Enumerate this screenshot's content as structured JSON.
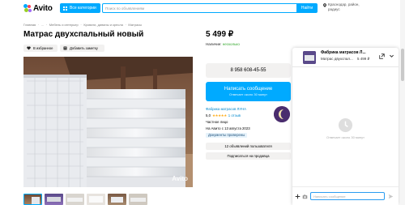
{
  "header": {
    "logo_text": "Avito",
    "categories_label": "Все категории",
    "search_placeholder": "Поиск по объявлениям",
    "find_label": "Найти",
    "location_line1": "Краснодар, район,",
    "location_line2": "радиус"
  },
  "breadcrumbs": [
    "Главная",
    "·",
    "...",
    "·",
    "Мебель и интерьер",
    "·",
    "Кровати, диваны и кресла",
    "·",
    "Матрасы"
  ],
  "listing": {
    "title": "Матрас двухспальный новый",
    "price": "5 499 ₽",
    "availability_label": "Наличие:",
    "availability_value": "несколько",
    "favorite_label": "В избранное",
    "note_label": "Добавить заметку",
    "photo_watermark": "Avito"
  },
  "contact": {
    "phone": "8 958 608-45-55",
    "message_label": "Написать сообщение",
    "message_sub": "Отвечает около 30 минут"
  },
  "seller": {
    "name": "Фабрика матрасов ЛУНА",
    "rating": "5,0",
    "stars": "★★★★★",
    "reviews": "1 отзыв",
    "type": "Частное лицо",
    "since": "На Авито с 13 августа 2023",
    "docs_badge": "Документы проверены",
    "ads_count": "12 объявлений пользователя",
    "subscribe_label": "Подписаться на продавца"
  },
  "chat": {
    "title": "Фабрика матрасов Л...",
    "subtitle": "Матрас двухспал...",
    "price": "5 499 ₽",
    "empty_text": "Отвечает около 30 минут",
    "input_placeholder": "Написать сообщение"
  },
  "colors": {
    "accent": "#00aaff",
    "background": "#ffffff",
    "button_gray": "#f2f1f0",
    "link": "#0088cc",
    "star": "#ffb021",
    "available": "#35a82f"
  }
}
